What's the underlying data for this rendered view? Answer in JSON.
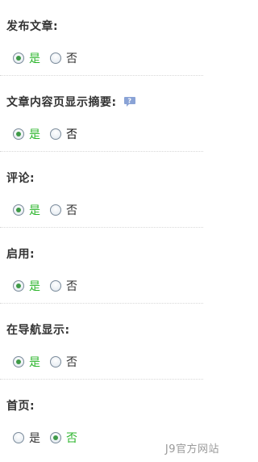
{
  "settings": [
    {
      "label": "发布文章:",
      "has_help": false,
      "options": [
        {
          "text": "是",
          "checked": true
        },
        {
          "text": "否",
          "checked": false
        }
      ]
    },
    {
      "label": "文章内容页显示摘要:",
      "has_help": true,
      "options": [
        {
          "text": "是",
          "checked": true
        },
        {
          "text": "否",
          "checked": false
        }
      ]
    },
    {
      "label": "评论:",
      "has_help": false,
      "options": [
        {
          "text": "是",
          "checked": true
        },
        {
          "text": "否",
          "checked": false
        }
      ]
    },
    {
      "label": "启用:",
      "has_help": false,
      "options": [
        {
          "text": "是",
          "checked": true
        },
        {
          "text": "否",
          "checked": false
        }
      ]
    },
    {
      "label": "在导航显示:",
      "has_help": false,
      "options": [
        {
          "text": "是",
          "checked": true
        },
        {
          "text": "否",
          "checked": false
        }
      ]
    },
    {
      "label": "首页:",
      "has_help": false,
      "options": [
        {
          "text": "是",
          "checked": false
        },
        {
          "text": "否",
          "checked": true
        }
      ]
    }
  ],
  "watermark": "J9官方网站",
  "colors": {
    "active_text": "#2bb52b",
    "radio_dot": "#3f9a48",
    "help_icon": "#8aa3d6"
  },
  "icons": {
    "help": "help-speech-bubble-icon"
  }
}
